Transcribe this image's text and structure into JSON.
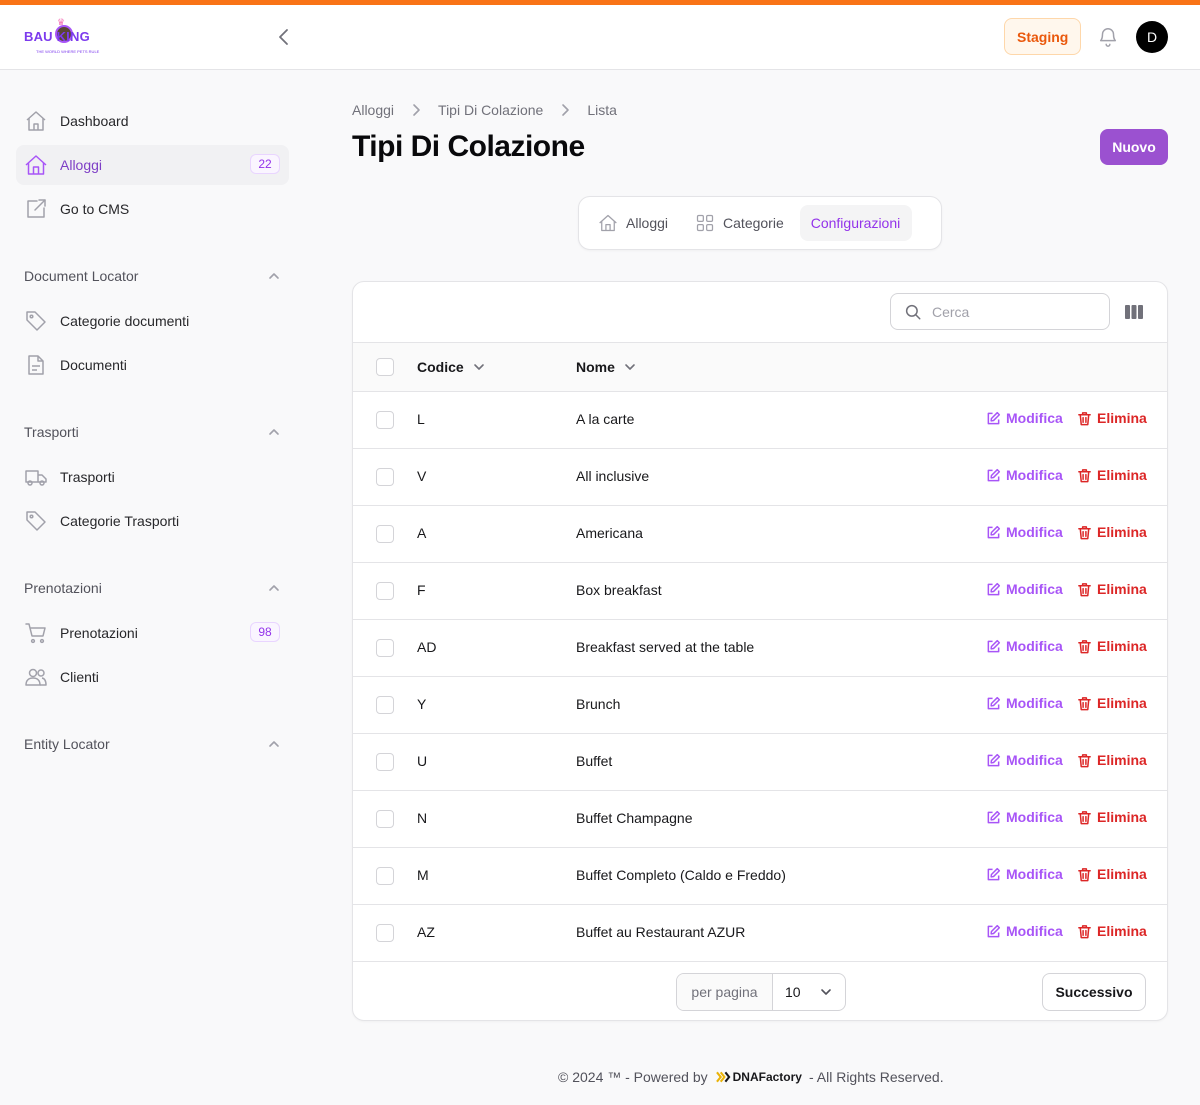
{
  "header": {
    "logo_text": "BAU  KING",
    "logo_tagline": "THE WORLD WHERE PETS RULE",
    "env_label": "Staging",
    "avatar_initial": "D"
  },
  "sidebar": {
    "top_items": [
      {
        "label": "Dashboard",
        "icon": "home-icon"
      },
      {
        "label": "Alloggi",
        "icon": "house-icon",
        "badge": "22",
        "active": true
      },
      {
        "label": "Go to CMS",
        "icon": "external-link-icon"
      }
    ],
    "groups": [
      {
        "title": "Document Locator",
        "items": [
          {
            "label": "Categorie documenti",
            "icon": "tag-icon"
          },
          {
            "label": "Documenti",
            "icon": "document-icon"
          }
        ]
      },
      {
        "title": "Trasporti",
        "items": [
          {
            "label": "Trasporti",
            "icon": "truck-icon"
          },
          {
            "label": "Categorie Trasporti",
            "icon": "tag-icon"
          }
        ]
      },
      {
        "title": "Prenotazioni",
        "items": [
          {
            "label": "Prenotazioni",
            "icon": "cart-icon",
            "badge": "98"
          },
          {
            "label": "Clienti",
            "icon": "users-icon"
          }
        ]
      },
      {
        "title": "Entity Locator",
        "items": []
      }
    ]
  },
  "breadcrumb": [
    "Alloggi",
    "Tipi Di Colazione",
    "Lista"
  ],
  "page": {
    "title": "Tipi Di Colazione",
    "new_button": "Nuovo"
  },
  "tabs": [
    {
      "label": "Alloggi",
      "icon": "house-icon"
    },
    {
      "label": "Categorie",
      "icon": "grid-icon"
    },
    {
      "label": "Configurazioni",
      "active": true
    }
  ],
  "table": {
    "search_placeholder": "Cerca",
    "columns": [
      "Codice",
      "Nome"
    ],
    "edit_label": "Modifica",
    "delete_label": "Elimina",
    "rows": [
      {
        "code": "L",
        "name": "A la carte"
      },
      {
        "code": "V",
        "name": "All inclusive"
      },
      {
        "code": "A",
        "name": "Americana"
      },
      {
        "code": "F",
        "name": "Box breakfast"
      },
      {
        "code": "AD",
        "name": "Breakfast served at the table"
      },
      {
        "code": "Y",
        "name": "Brunch"
      },
      {
        "code": "U",
        "name": "Buffet"
      },
      {
        "code": "N",
        "name": "Buffet Champagne"
      },
      {
        "code": "M",
        "name": "Buffet Completo (Caldo e Freddo)"
      },
      {
        "code": "AZ",
        "name": "Buffet au Restaurant AZUR"
      }
    ]
  },
  "pagination": {
    "per_page_label": "per pagina",
    "per_page_value": "10",
    "next_label": "Successivo"
  },
  "footer": {
    "left": "© 2024 ™ - Powered by",
    "brand": "DNAFactory",
    "right": "- All Rights Reserved."
  },
  "colors": {
    "accent": "#9b51d0",
    "top_bar": "#f97316",
    "danger": "#dc2626"
  }
}
